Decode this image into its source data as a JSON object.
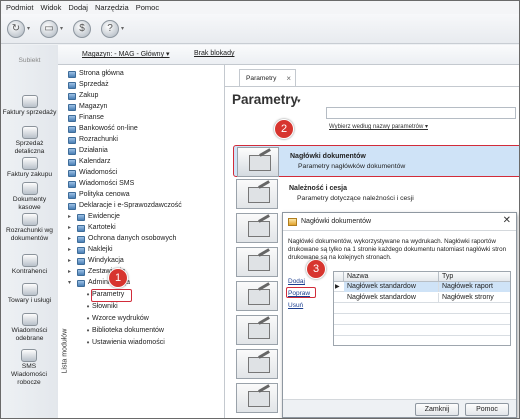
{
  "menu": [
    "Podmiot",
    "Widok",
    "Dodaj",
    "Narzędzia",
    "Pomoc"
  ],
  "toolbar": {
    "buttons": [
      "refresh-icon",
      "document-icon",
      "currency-icon",
      "help-icon"
    ]
  },
  "left_nav": {
    "subiekt": "Subiekt",
    "items": [
      "Faktury sprzedaży",
      "Sprzedaż detaliczna",
      "Faktury zakupu",
      "Dokumenty kasowe",
      "Rozrachunki wg dokumentów",
      "Kontrahenci",
      "Towary i usługi",
      "Wiadomości odebrane",
      "SMS Wiadomości robocze"
    ]
  },
  "header": {
    "warehouse": "Magazyn: - MAG - Główny ▾",
    "block": "Brak blokady"
  },
  "tree": {
    "vertical_label": "Lista modułów",
    "items": [
      "Strona główna",
      "Sprzedaż",
      "Zakup",
      "Magazyn",
      "Finanse",
      "Bankowość on-line",
      "Rozrachunki",
      "Działania",
      "Kalendarz",
      "Wiadomości",
      "Wiadomości SMS",
      "Polityka cenowa",
      "Deklaracje i e-Sprawozdawczość",
      "Ewidencje",
      "Kartoteki",
      "Ochrona danych osobowych",
      "Naklejki",
      "Windykacja",
      "Zestawienia",
      "Administracja"
    ],
    "children": [
      "Parametry",
      "Słowniki",
      "Wzorce wydruków",
      "Biblioteka dokumentów",
      "Ustawienia wiadomości"
    ]
  },
  "tab": {
    "label": "Parametry",
    "close": "×"
  },
  "main": {
    "title": "Parametry",
    "title_dropdown": "▾",
    "search_hint": "Wybierz według nazwy parametrów ▾",
    "rows": [
      {
        "title": "Nagłówki dokumentów",
        "desc": "Parametry nagłówków dokumentów"
      },
      {
        "title": "Należność i cesja",
        "desc": "Parametry dotyczące należności i cesji"
      }
    ]
  },
  "dialog": {
    "title": "Nagłówki dokumentów",
    "close": "✕",
    "description": "Nagłówki dokumentów, wykorzystywane na wydrukach. Nagłówki raportów drukowane są tylko na 1 stronie każdego dokumentu natomiast nagłówki stron drukowane są na kolejnych stronach.",
    "links": [
      "Dodaj",
      "Popraw",
      "Usuń"
    ],
    "columns": [
      "Nazwa",
      "Typ"
    ],
    "rows": [
      {
        "name": "Nagłówek standardow",
        "type": "Nagłówek raport"
      },
      {
        "name": "Nagłówek standardow",
        "type": "Nagłówek strony"
      }
    ],
    "buttons": {
      "ok": "Zamknij",
      "help": "Pomoc"
    }
  },
  "annotations": [
    "1",
    "2",
    "3"
  ],
  "colors": {
    "highlight": "#d12c3a",
    "badge": "#d7352f",
    "selection": "#cfe3f7",
    "link": "#1a3d8f"
  }
}
